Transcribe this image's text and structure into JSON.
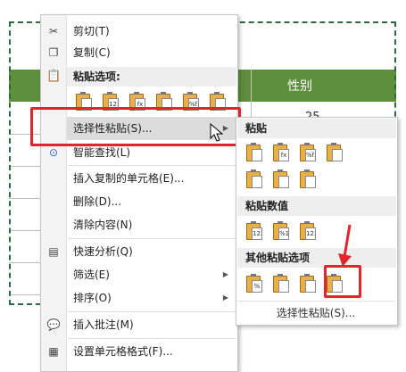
{
  "sheet": {
    "header_cell": "性别",
    "partial_value": "25"
  },
  "menu": {
    "cut": "剪切(T)",
    "copy": "复制(C)",
    "paste_options_title": "粘贴选项:",
    "paste_special": "选择性粘贴(S)...",
    "smart_lookup": "智能查找(L)",
    "insert_copied": "插入复制的单元格(E)...",
    "delete": "删除(D)...",
    "clear": "清除内容(N)",
    "quick_analysis": "快速分析(Q)",
    "filter": "筛选(E)",
    "sort": "排序(O)",
    "insert_comment": "插入批注(M)",
    "format_cells": "设置单元格格式(F)..."
  },
  "submenu": {
    "paste": "粘贴",
    "paste_values": "粘贴数值",
    "other_paste": "其他粘贴选项",
    "footer": "选择性粘贴(S)..."
  },
  "colors": {
    "highlight_red": "#e0262b",
    "header_green": "#5e8f3c"
  },
  "icons": {
    "paste_option_labels": [
      "",
      "123",
      "fx",
      "",
      "%fx",
      ""
    ],
    "sub_paste_labels": [
      "",
      "fx",
      "%fx",
      "",
      "",
      "",
      ""
    ],
    "sub_value_labels": [
      "123",
      "%123",
      "123"
    ],
    "sub_other_labels": [
      "%",
      "",
      "",
      ""
    ]
  }
}
